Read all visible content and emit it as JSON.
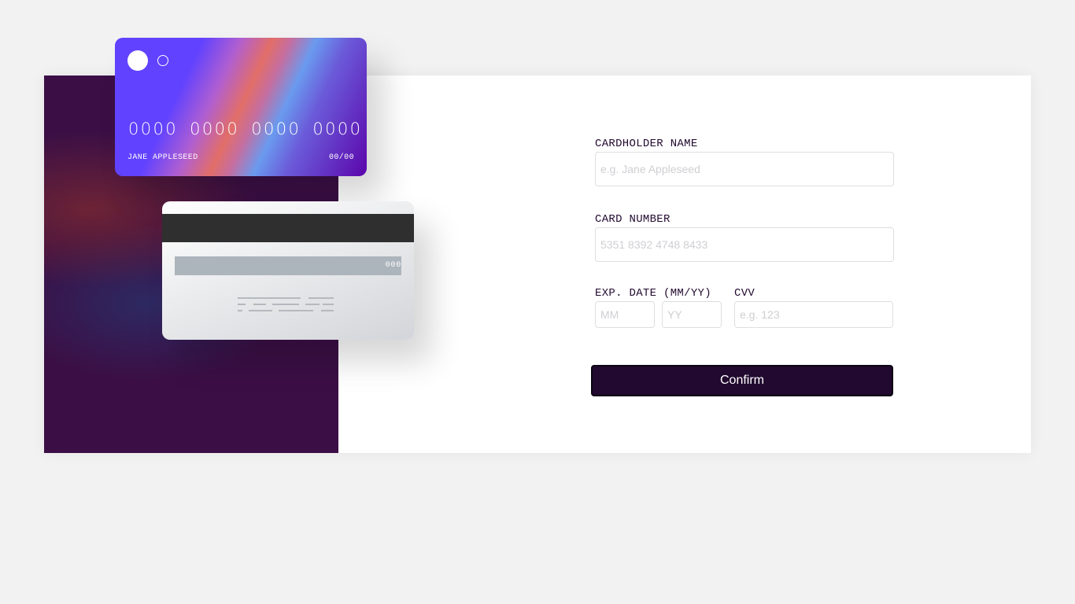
{
  "card_front": {
    "number": "0000 0000 0000 0000",
    "name": "JANE APPLESEED",
    "expiry": "00/00"
  },
  "card_back": {
    "cvv": "000"
  },
  "form": {
    "name": {
      "label": "CARDHOLDER NAME",
      "placeholder": "e.g. Jane Appleseed"
    },
    "number": {
      "label": "CARD NUMBER",
      "placeholder": "5351 8392 4748 8433"
    },
    "expiry": {
      "label": "EXP. DATE (MM/YY)",
      "month_placeholder": "MM",
      "year_placeholder": "YY"
    },
    "cvv": {
      "label": "CVV",
      "placeholder": "e.g. 123"
    },
    "confirm_label": "Confirm"
  },
  "colors": {
    "page_background": "#f2f2f2",
    "left_panel": "#3b0f45",
    "button": "#21092f",
    "card_front_start": "#6142ff",
    "card_front_end": "#5b05ab"
  }
}
